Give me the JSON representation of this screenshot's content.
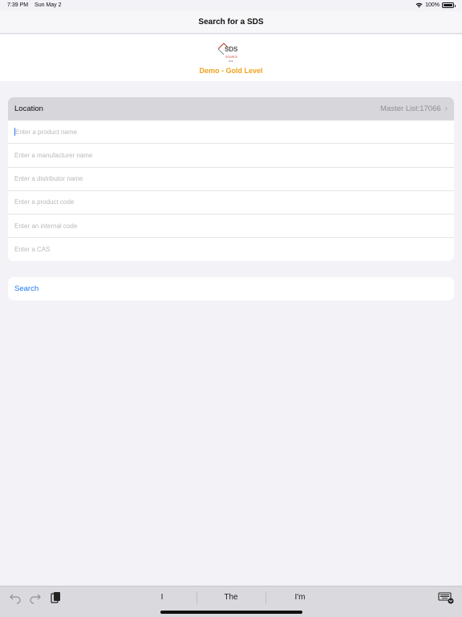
{
  "status": {
    "time": "7:39 PM",
    "date": "Sun May 2",
    "battery": "100%"
  },
  "nav": {
    "title": "Search for a SDS"
  },
  "header": {
    "logo_text": "SDS",
    "logo_sub": "SOURCE",
    "logo_sub2": "Link",
    "level": "Demo - Gold Level",
    "level_color": "#f0a01e"
  },
  "form": {
    "location_label": "Location",
    "location_value": "Master List:17066",
    "fields": [
      {
        "placeholder": "Enter a product name"
      },
      {
        "placeholder": "Enter a manufacturer name"
      },
      {
        "placeholder": "Enter a distributor name"
      },
      {
        "placeholder": "Enter a product code"
      },
      {
        "placeholder": "Enter an internal code"
      },
      {
        "placeholder": "Enter a CAS"
      }
    ]
  },
  "search": {
    "label": "Search",
    "color": "#1d7cf2"
  },
  "keyboard": {
    "predictions": [
      "I",
      "The",
      "I'm"
    ]
  }
}
